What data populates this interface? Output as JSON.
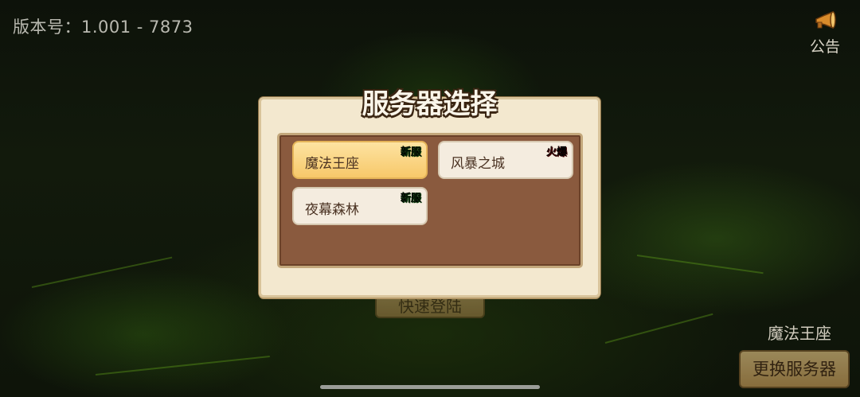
{
  "header": {
    "version_text": "版本号：1.001 - 7873",
    "notice_label": "公告",
    "notice_icon": "horn-icon"
  },
  "background": {
    "quick_login_label": "快速登陆"
  },
  "dialog": {
    "title": "服务器选择",
    "servers": [
      {
        "name": "魔法王座",
        "badge": "新服",
        "badge_type": "new",
        "selected": true
      },
      {
        "name": "风暴之城",
        "badge": "火爆",
        "badge_type": "hot",
        "selected": false
      },
      {
        "name": "夜幕森林",
        "badge": "新服",
        "badge_type": "new",
        "selected": false
      }
    ]
  },
  "footer": {
    "current_server": "魔法王座",
    "change_server_label": "更换服务器"
  },
  "colors": {
    "new_badge": "#3fd83b",
    "hot_badge": "#e31515",
    "selected_item": "#f7c86a",
    "panel_brown": "#8a5a3e"
  }
}
